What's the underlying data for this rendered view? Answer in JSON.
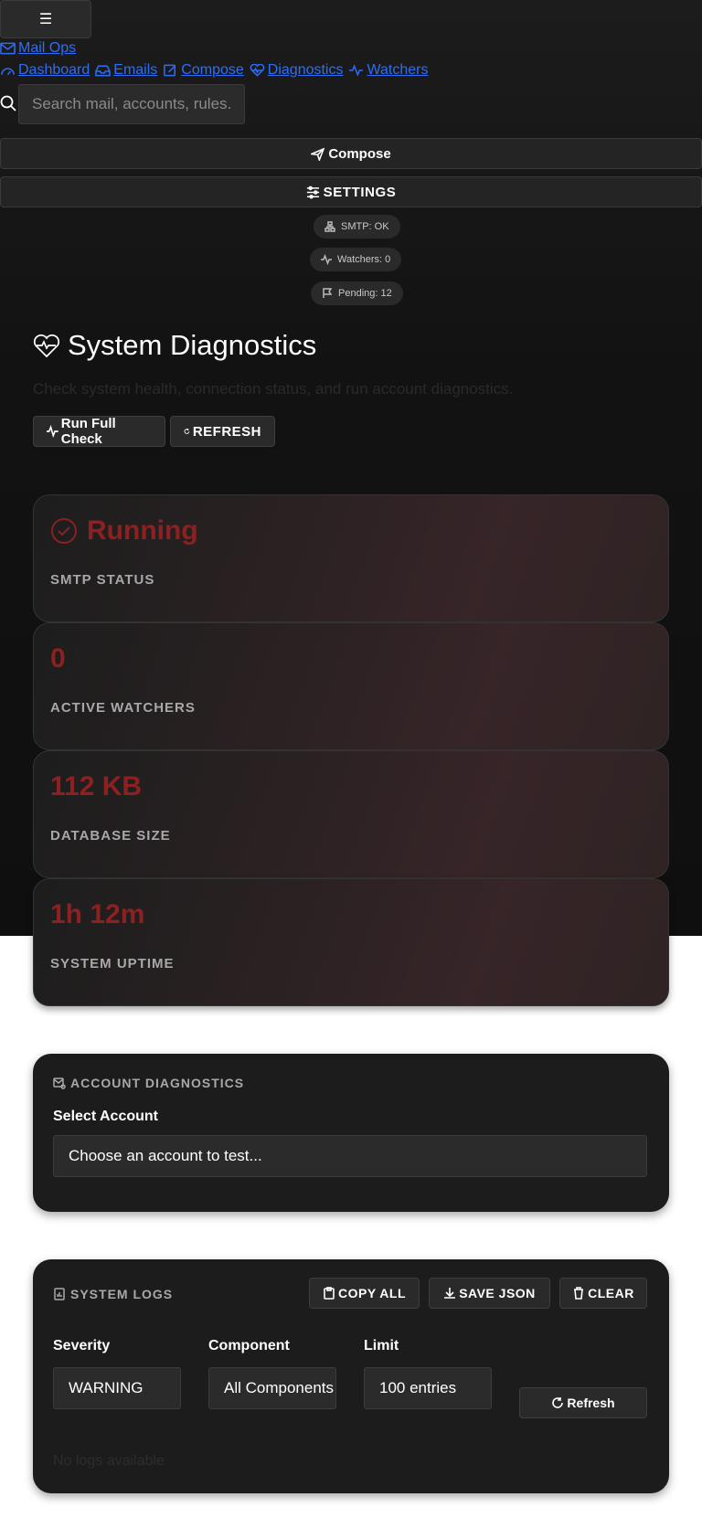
{
  "topbar": {
    "menu_glyph": "☰",
    "brand": "Mail Ops",
    "nav": [
      {
        "label": "Dashboard",
        "icon": "gauge-icon"
      },
      {
        "label": "Emails",
        "icon": "inbox-icon"
      },
      {
        "label": "Compose",
        "icon": "edit-icon"
      },
      {
        "label": "Diagnostics",
        "icon": "heart-pulse-icon"
      },
      {
        "label": "Watchers",
        "icon": "activity-icon"
      }
    ],
    "search_placeholder": "Search mail, accounts, rules...",
    "compose_label": "Compose",
    "settings_label": "SETTINGS"
  },
  "status_pills": {
    "smtp": "SMTP: OK",
    "watchers": "Watchers: 0",
    "pending": "Pending: 12"
  },
  "header": {
    "title": "System Diagnostics",
    "subtitle": "Check system health, connection status, and run account diagnostics.",
    "run_check_label": "Run Full Check",
    "refresh_label": "REFRESH"
  },
  "stats": [
    {
      "value": "Running",
      "label": "SMTP STATUS"
    },
    {
      "value": "0",
      "label": "ACTIVE WATCHERS"
    },
    {
      "value": "112 KB",
      "label": "DATABASE SIZE"
    },
    {
      "value": "1h 12m",
      "label": "SYSTEM UPTIME"
    }
  ],
  "account_diag": {
    "heading": "ACCOUNT DIAGNOSTICS",
    "select_label": "Select Account",
    "select_value": "Choose an account to test..."
  },
  "logs": {
    "heading": "SYSTEM LOGS",
    "copy_all": "COPY ALL",
    "save_json": "SAVE JSON",
    "clear": "CLEAR",
    "severity_label": "Severity",
    "severity_value": "WARNING",
    "component_label": "Component",
    "component_value": "All Components",
    "limit_label": "Limit",
    "limit_value": "100 entries",
    "refresh_label": "Refresh",
    "empty": "No logs available"
  },
  "colors": {
    "accent_red": "#8d2020",
    "link_blue": "#2f6df6"
  }
}
